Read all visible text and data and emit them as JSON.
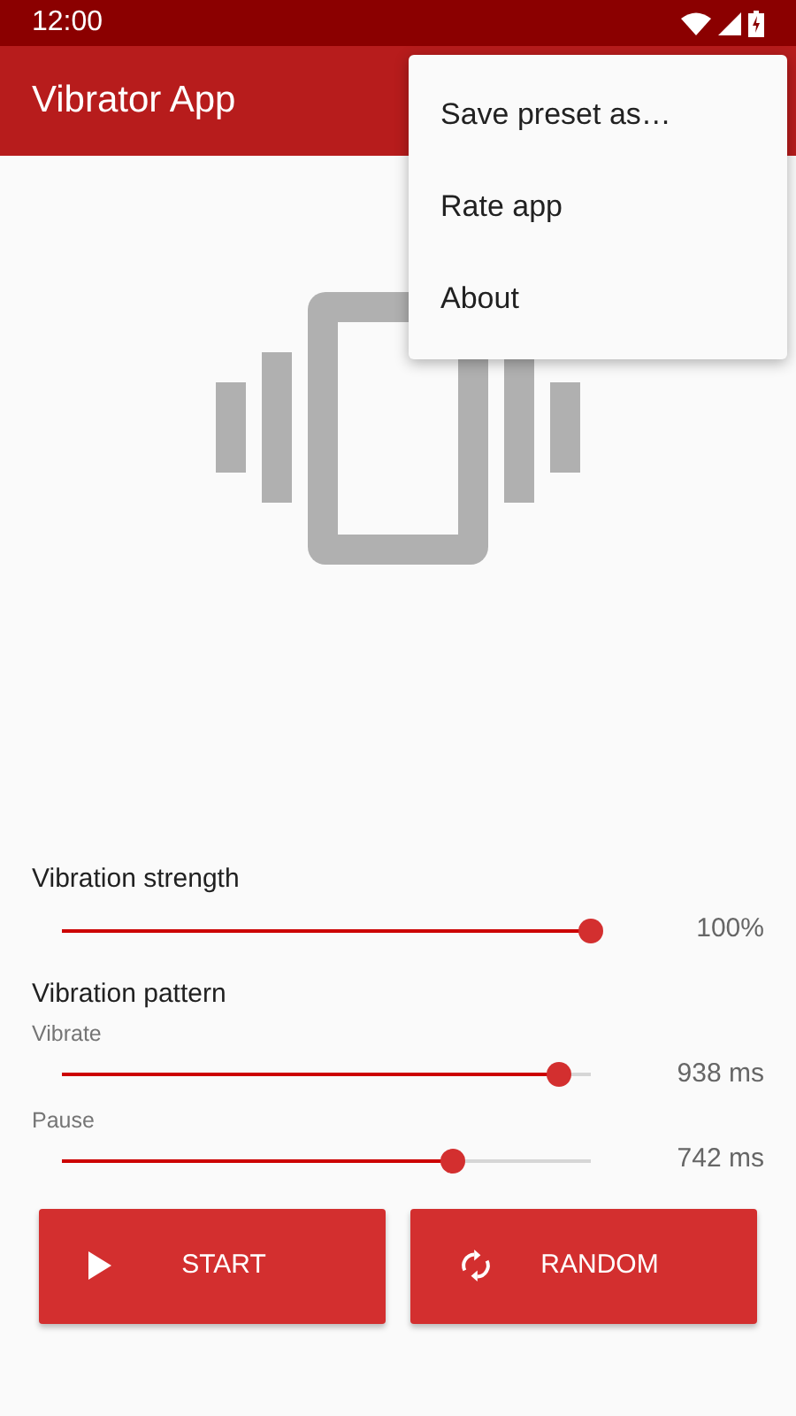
{
  "status_bar": {
    "time": "12:00"
  },
  "app_bar": {
    "title": "Vibrator App"
  },
  "menu": {
    "items": [
      {
        "label": "Save preset as…"
      },
      {
        "label": "Rate app"
      },
      {
        "label": "About"
      }
    ]
  },
  "strength": {
    "title": "Vibration strength",
    "level": 1.0,
    "reading": "100%"
  },
  "pattern": {
    "title": "Vibration pattern",
    "sliders": [
      {
        "label": "Vibrate",
        "level": 0.94,
        "reading": "938 ms"
      },
      {
        "label": "Pause",
        "level": 0.74,
        "reading": "742 ms"
      }
    ]
  },
  "buttons": [
    {
      "kind": "play",
      "label": "START"
    },
    {
      "kind": "shuffle",
      "label": "RANDOM"
    }
  ]
}
